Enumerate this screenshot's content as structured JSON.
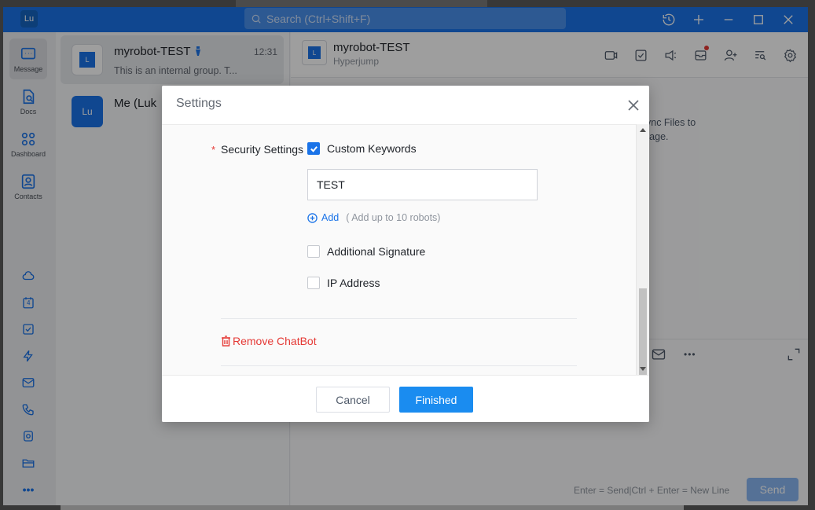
{
  "window": {
    "app_logo": "Lu",
    "search_placeholder": "Search (Ctrl+Shift+F)",
    "title_icons": [
      "history-icon",
      "plus-icon",
      "minimize-icon",
      "maximize-icon",
      "close-icon"
    ]
  },
  "nav": {
    "items": [
      {
        "label": "Message",
        "icon": "message-icon",
        "active": true
      },
      {
        "label": "Docs",
        "icon": "docs-icon"
      },
      {
        "label": "Dashboard",
        "icon": "dashboard-icon"
      },
      {
        "label": "Contacts",
        "icon": "contacts-icon"
      }
    ],
    "tools": [
      "cloud-icon",
      "calendar-icon",
      "task-icon",
      "lightning-icon",
      "mail-icon",
      "phone-icon",
      "note-icon",
      "folder-icon",
      "more-icon"
    ],
    "calendar_day": "4"
  },
  "chat_list": {
    "items": [
      {
        "name": "myrobot-TEST",
        "time": "12:31",
        "preview": "This is an internal group. T...",
        "avatar": "L"
      },
      {
        "name": "Me (Luk",
        "avatar": "Lu"
      }
    ]
  },
  "chat": {
    "title": "myrobot-TEST",
    "subtitle": "Hyperjump",
    "avatar": "L",
    "sync_line1": "ync Files to",
    "sync_line2": "rage.",
    "more": "•••",
    "hint": "Enter = Send|Ctrl + Enter = New Line",
    "send_label": "Send"
  },
  "modal": {
    "title": "Settings",
    "required_mark": "*",
    "security_label": "Security Settings",
    "custom_keywords": "Custom Keywords",
    "keyword_value": "TEST",
    "add_label": "Add",
    "add_hint": "( Add up to 10 robots)",
    "additional_signature": "Additional Signature",
    "ip_address": "IP Address",
    "remove_label": "Remove ChatBot",
    "cancel_label": "Cancel",
    "finish_label": "Finished"
  }
}
